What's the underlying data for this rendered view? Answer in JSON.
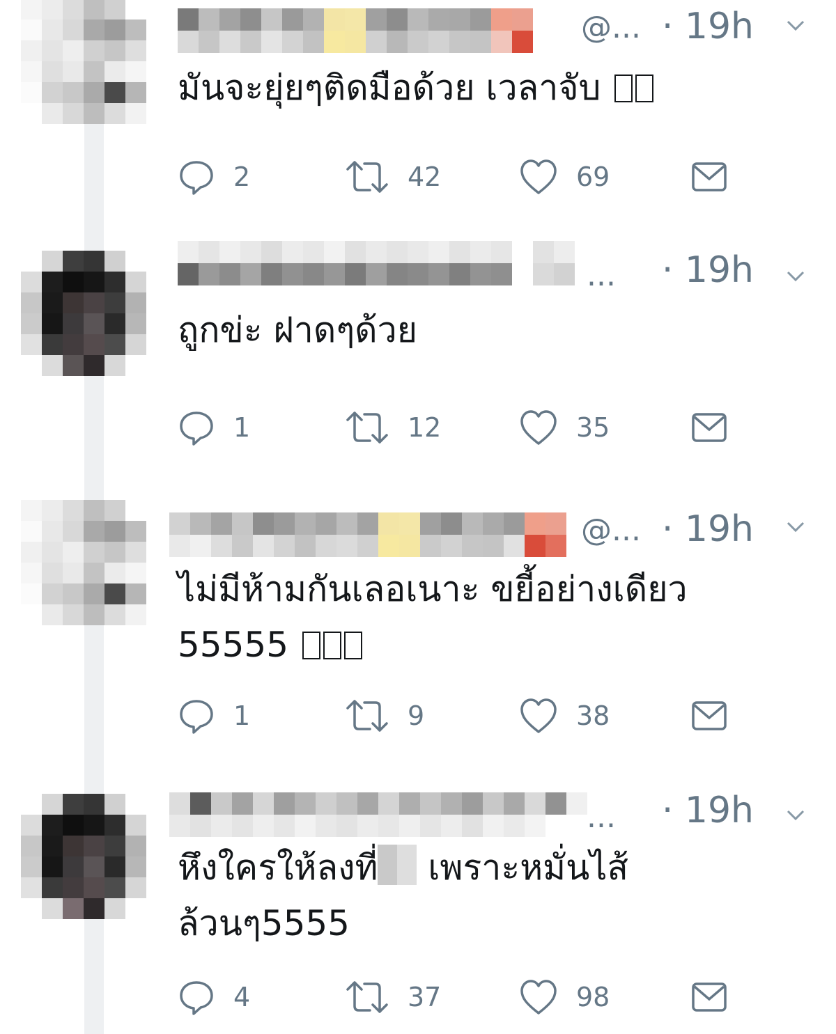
{
  "tweets": [
    {
      "handle": "@...",
      "time": "· 19h",
      "text": "มันจะยุ่ยๆติดมือด้วย เวลาจับ",
      "text_extra": "",
      "reply_count": "2",
      "retweet_count": "42",
      "like_count": "69"
    },
    {
      "handle": "...",
      "time": "· 19h",
      "text": "ถูกข่ะ ฝาดๆด้วย",
      "text_extra": "",
      "reply_count": "1",
      "retweet_count": "12",
      "like_count": "35"
    },
    {
      "handle": "@...",
      "time": "· 19h",
      "text": "ไม่มีห้ามกันเลอเนาะ ขยี้อย่างเดียว",
      "text_extra": "55555",
      "reply_count": "1",
      "retweet_count": "9",
      "like_count": "38"
    },
    {
      "handle": "...",
      "time": "· 19h",
      "text": "หึงใครให้ลงที่",
      "text_after": "เพราะหมั่นไส้",
      "text_extra": "ล้วนๆ5555",
      "reply_count": "4",
      "retweet_count": "37",
      "like_count": "98"
    }
  ],
  "colors": {
    "text": "#14171a",
    "muted": "#657786",
    "thread_line": "#eef0f2"
  },
  "icons": [
    "reply-icon",
    "retweet-icon",
    "like-icon",
    "dm-icon",
    "chevron-down-icon"
  ]
}
